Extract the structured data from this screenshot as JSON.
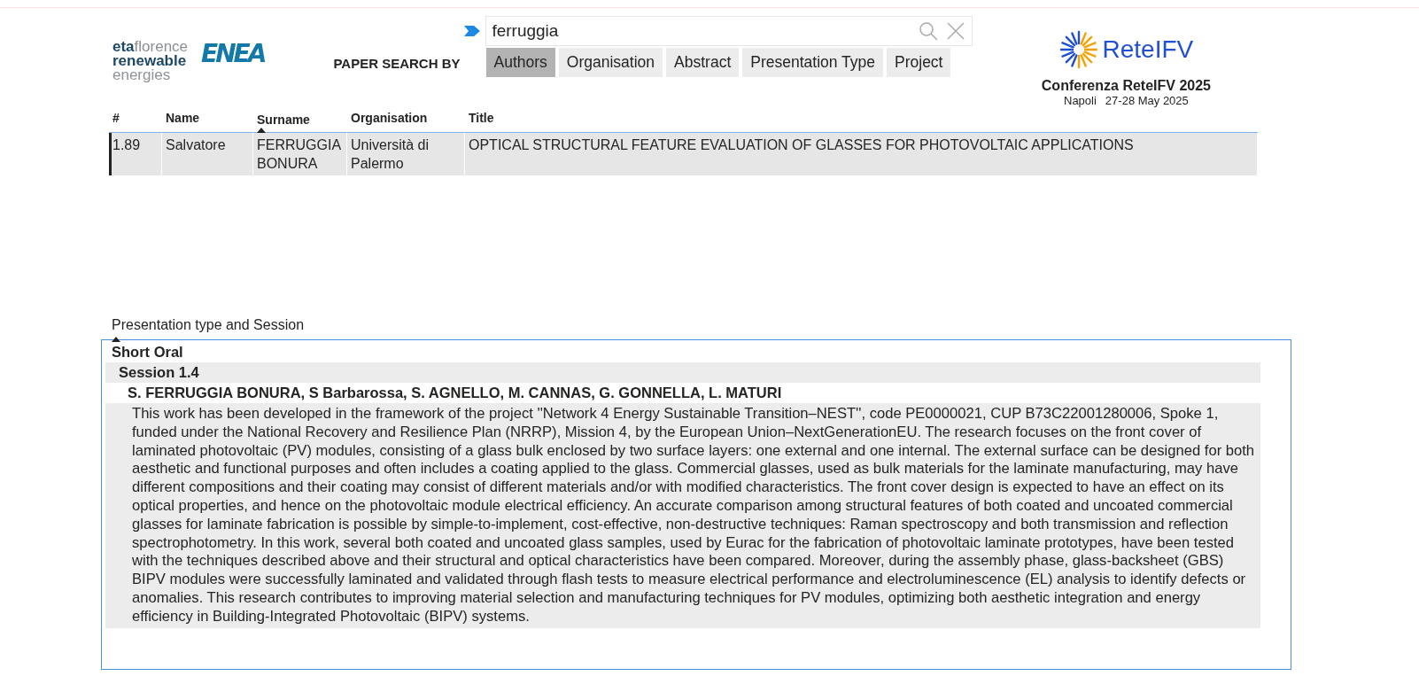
{
  "logos": {
    "eta": {
      "line1_bold": "eta",
      "line1_light": "florence",
      "line2": "renewable",
      "line3": "energies"
    },
    "enea": "ENEA",
    "retei": "ReteIFV"
  },
  "search": {
    "value": "ferruggia",
    "label": "PAPER SEARCH BY"
  },
  "tabs": [
    {
      "label": "Authors",
      "selected": true
    },
    {
      "label": "Organisation",
      "selected": false
    },
    {
      "label": "Abstract",
      "selected": false
    },
    {
      "label": "Presentation Type",
      "selected": false
    },
    {
      "label": "Project",
      "selected": false
    }
  ],
  "conference": {
    "title": "Conferenza ReteIFV 2025",
    "place": "Napoli",
    "dates": "27-28 May 2025"
  },
  "table": {
    "columns": [
      {
        "label": "#",
        "sorted": false
      },
      {
        "label": "Name",
        "sorted": false
      },
      {
        "label": "Surname",
        "sorted": true
      },
      {
        "label": "Organisation",
        "sorted": false
      },
      {
        "label": "Title",
        "sorted": false
      }
    ],
    "rows": [
      {
        "cells": [
          "1.89",
          "Salvatore",
          "FERRUGGIA BONURA",
          "Università di Palermo",
          "OPTICAL STRUCTURAL FEATURE EVALUATION OF GLASSES FOR PHOTOVOLTAIC APPLICATIONS"
        ],
        "selected": true
      }
    ]
  },
  "details": {
    "heading": "Presentation type and Session",
    "type": "Short Oral",
    "session": "Session 1.4",
    "authors": "S. FERRUGGIA BONURA, S Barbarossa, S. AGNELLO, M. CANNAS, G. GONNELLA, L. MATURI",
    "abstract": "This work has been developed in the framework of the project ''Network 4 Energy Sustainable Transition–NEST'', code PE0000021, CUP B73C22001280006, Spoke 1, funded under the National Recovery and Resilience Plan (NRRP), Mission 4, by the European Union–NextGenerationEU. The research focuses on the front cover of laminated photovoltaic (PV) modules, consisting of a glass bulk enclosed by two surface layers: one external and one internal. The external surface can be designed for both aesthetic and functional purposes and often includes a coating applied to the glass. Commercial glasses, used as bulk materials for the laminate manufacturing, may have different compositions and their coating may consist of different materials and/or with modified characteristics. The front cover design is expected to have an effect on its optical properties, and hence on the photovoltaic module electrical efficiency. An accurate comparison among structural features of both coated and uncoated commercial glasses for laminate fabrication is possible by simple-to-implement, cost-effective, non-destructive techniques: Raman spectroscopy and both transmission and reflection spectrophotometry. In this work, several both coated and uncoated glass samples, used by Eurac for the fabrication of photovoltaic laminate prototypes, have been tested with the techniques described above and their structural and optical characteristics have been compared. Moreover, during the assembly phase, glass-backsheet (GBS) BIPV modules were successfully laminated and validated through flash tests to measure electrical performance and electroluminescence (EL) analysis to identify defects or anomalies. This research contributes to improving material selection and manufacturing techniques for PV modules, optimizing both aesthetic integration and energy efficiency in Building-Integrated Photovoltaic (BIPV) systems."
  }
}
